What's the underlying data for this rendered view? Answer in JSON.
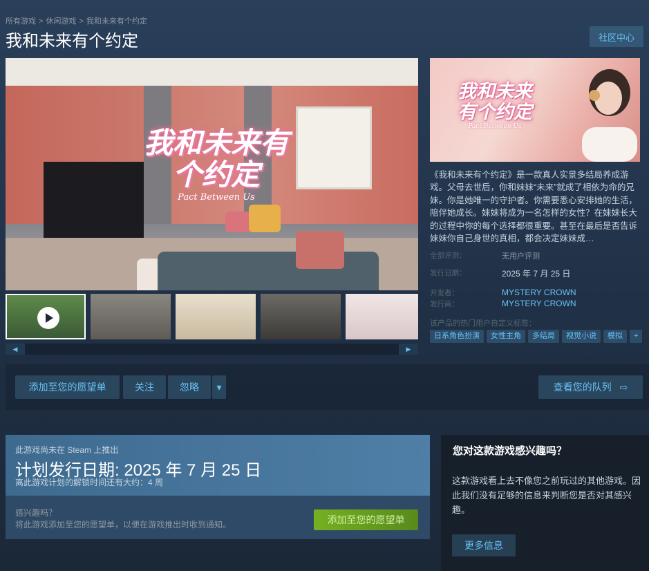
{
  "breadcrumb": {
    "items": [
      "所有游戏",
      "休闲游戏",
      "我和未来有个约定"
    ],
    "separator": ">"
  },
  "page": {
    "title": "我和未来有个约定",
    "community_button": "社区中心"
  },
  "media": {
    "logo_cn": "我和未来有个约定",
    "logo_en": "Pact Between Us",
    "thumbnails": [
      "video",
      "screenshot-1",
      "screenshot-2",
      "screenshot-3",
      "screenshot-4"
    ],
    "slider_left": "◀",
    "slider_right": "▶"
  },
  "capsule": {
    "logo_cn_line1": "我和未来",
    "logo_cn_line2": "有个约定",
    "logo_en": "Pact Between Us"
  },
  "description": "《我和未来有个约定》是一款真人实景多结局养成游戏。父母去世后，你和妹妹“未来”就成了相依为命的兄妹。你是她唯一的守护者。你需要悉心安排她的生活，陪伴她成长。妹妹将成为一名怎样的女性？在妹妹长大的过程中你的每个选择都很重要。甚至在最后是否告诉妹妹你自己身世的真相，都会决定妹妹成…",
  "info": {
    "reviews_label": "全部评测：",
    "reviews_value": "无用户评测",
    "release_label": "发行日期：",
    "release_value": "2025 年 7 月 25 日",
    "developer_label": "开发者：",
    "developer_value": "MYSTERY CROWN",
    "publisher_label": "发行商：",
    "publisher_value": "MYSTERY CROWN"
  },
  "tags": {
    "label": "该产品的热门用户自定义标签：",
    "items": [
      "日系角色扮演",
      "女性主角",
      "多结局",
      "视觉小说",
      "模拟",
      "+"
    ]
  },
  "actions": {
    "wishlist": "添加至您的愿望单",
    "follow": "关注",
    "ignore": "忽略",
    "dropdown": "▾",
    "queue": "查看您的队列",
    "queue_icon": "⇨"
  },
  "release": {
    "not_released": "此游戏尚未在 Steam 上推出",
    "planned": "计划发行日期: 2025 年 7 月 25 日",
    "unlock_time": "离此游戏计划的解锁时间还有大约：4 周",
    "interested_q": "感兴趣吗？",
    "interested_text": "将此游戏添加至您的愿望单，以便在游戏推出时收到通知。",
    "wishlist_button": "添加至您的愿望单"
  },
  "interest_panel": {
    "title": "您对这款游戏感兴趣吗？",
    "text": "这款游戏看上去不像您之前玩过的其他游戏。因此我们没有足够的信息来判断您是否对其感兴趣。",
    "more_info": "更多信息"
  },
  "colors": {
    "accent": "#67c1f5",
    "green_button": "#75b022",
    "background": "#1b2838"
  }
}
